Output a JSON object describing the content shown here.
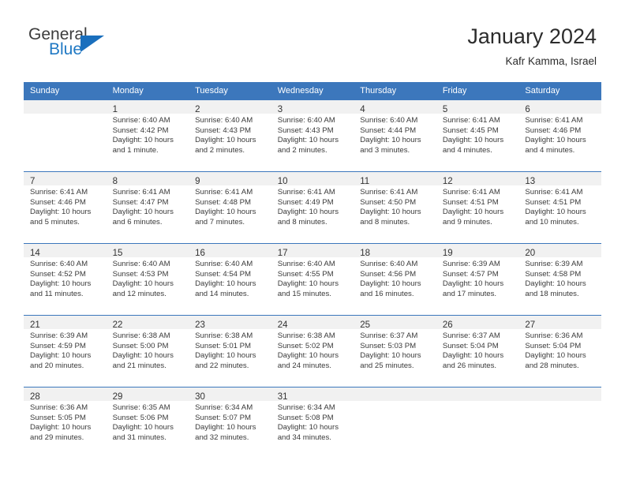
{
  "brand": {
    "name_top": "General",
    "name_bottom": "Blue",
    "color_dark": "#3c3c3c",
    "color_blue": "#2079c4"
  },
  "header": {
    "title": "January 2024",
    "subtitle": "Kafr Kamma, Israel"
  },
  "theme": {
    "header_blue": "#3c77bc",
    "daynum_band": "#f1f1f1",
    "text": "#3a3a3a"
  },
  "weekday_headers": [
    "Sunday",
    "Monday",
    "Tuesday",
    "Wednesday",
    "Thursday",
    "Friday",
    "Saturday"
  ],
  "labels": {
    "sunrise_prefix": "Sunrise:",
    "sunset_prefix": "Sunset:",
    "daylight_prefix": "Daylight:"
  },
  "weeks": [
    [
      {
        "day": "",
        "sunrise": "",
        "sunset": "",
        "daylight_line1": "",
        "daylight_line2": ""
      },
      {
        "day": "1",
        "sunrise": "Sunrise: 6:40 AM",
        "sunset": "Sunset: 4:42 PM",
        "daylight_line1": "Daylight: 10 hours",
        "daylight_line2": "and 1 minute."
      },
      {
        "day": "2",
        "sunrise": "Sunrise: 6:40 AM",
        "sunset": "Sunset: 4:43 PM",
        "daylight_line1": "Daylight: 10 hours",
        "daylight_line2": "and 2 minutes."
      },
      {
        "day": "3",
        "sunrise": "Sunrise: 6:40 AM",
        "sunset": "Sunset: 4:43 PM",
        "daylight_line1": "Daylight: 10 hours",
        "daylight_line2": "and 2 minutes."
      },
      {
        "day": "4",
        "sunrise": "Sunrise: 6:40 AM",
        "sunset": "Sunset: 4:44 PM",
        "daylight_line1": "Daylight: 10 hours",
        "daylight_line2": "and 3 minutes."
      },
      {
        "day": "5",
        "sunrise": "Sunrise: 6:41 AM",
        "sunset": "Sunset: 4:45 PM",
        "daylight_line1": "Daylight: 10 hours",
        "daylight_line2": "and 4 minutes."
      },
      {
        "day": "6",
        "sunrise": "Sunrise: 6:41 AM",
        "sunset": "Sunset: 4:46 PM",
        "daylight_line1": "Daylight: 10 hours",
        "daylight_line2": "and 4 minutes."
      }
    ],
    [
      {
        "day": "7",
        "sunrise": "Sunrise: 6:41 AM",
        "sunset": "Sunset: 4:46 PM",
        "daylight_line1": "Daylight: 10 hours",
        "daylight_line2": "and 5 minutes."
      },
      {
        "day": "8",
        "sunrise": "Sunrise: 6:41 AM",
        "sunset": "Sunset: 4:47 PM",
        "daylight_line1": "Daylight: 10 hours",
        "daylight_line2": "and 6 minutes."
      },
      {
        "day": "9",
        "sunrise": "Sunrise: 6:41 AM",
        "sunset": "Sunset: 4:48 PM",
        "daylight_line1": "Daylight: 10 hours",
        "daylight_line2": "and 7 minutes."
      },
      {
        "day": "10",
        "sunrise": "Sunrise: 6:41 AM",
        "sunset": "Sunset: 4:49 PM",
        "daylight_line1": "Daylight: 10 hours",
        "daylight_line2": "and 8 minutes."
      },
      {
        "day": "11",
        "sunrise": "Sunrise: 6:41 AM",
        "sunset": "Sunset: 4:50 PM",
        "daylight_line1": "Daylight: 10 hours",
        "daylight_line2": "and 8 minutes."
      },
      {
        "day": "12",
        "sunrise": "Sunrise: 6:41 AM",
        "sunset": "Sunset: 4:51 PM",
        "daylight_line1": "Daylight: 10 hours",
        "daylight_line2": "and 9 minutes."
      },
      {
        "day": "13",
        "sunrise": "Sunrise: 6:41 AM",
        "sunset": "Sunset: 4:51 PM",
        "daylight_line1": "Daylight: 10 hours",
        "daylight_line2": "and 10 minutes."
      }
    ],
    [
      {
        "day": "14",
        "sunrise": "Sunrise: 6:40 AM",
        "sunset": "Sunset: 4:52 PM",
        "daylight_line1": "Daylight: 10 hours",
        "daylight_line2": "and 11 minutes."
      },
      {
        "day": "15",
        "sunrise": "Sunrise: 6:40 AM",
        "sunset": "Sunset: 4:53 PM",
        "daylight_line1": "Daylight: 10 hours",
        "daylight_line2": "and 12 minutes."
      },
      {
        "day": "16",
        "sunrise": "Sunrise: 6:40 AM",
        "sunset": "Sunset: 4:54 PM",
        "daylight_line1": "Daylight: 10 hours",
        "daylight_line2": "and 14 minutes."
      },
      {
        "day": "17",
        "sunrise": "Sunrise: 6:40 AM",
        "sunset": "Sunset: 4:55 PM",
        "daylight_line1": "Daylight: 10 hours",
        "daylight_line2": "and 15 minutes."
      },
      {
        "day": "18",
        "sunrise": "Sunrise: 6:40 AM",
        "sunset": "Sunset: 4:56 PM",
        "daylight_line1": "Daylight: 10 hours",
        "daylight_line2": "and 16 minutes."
      },
      {
        "day": "19",
        "sunrise": "Sunrise: 6:39 AM",
        "sunset": "Sunset: 4:57 PM",
        "daylight_line1": "Daylight: 10 hours",
        "daylight_line2": "and 17 minutes."
      },
      {
        "day": "20",
        "sunrise": "Sunrise: 6:39 AM",
        "sunset": "Sunset: 4:58 PM",
        "daylight_line1": "Daylight: 10 hours",
        "daylight_line2": "and 18 minutes."
      }
    ],
    [
      {
        "day": "21",
        "sunrise": "Sunrise: 6:39 AM",
        "sunset": "Sunset: 4:59 PM",
        "daylight_line1": "Daylight: 10 hours",
        "daylight_line2": "and 20 minutes."
      },
      {
        "day": "22",
        "sunrise": "Sunrise: 6:38 AM",
        "sunset": "Sunset: 5:00 PM",
        "daylight_line1": "Daylight: 10 hours",
        "daylight_line2": "and 21 minutes."
      },
      {
        "day": "23",
        "sunrise": "Sunrise: 6:38 AM",
        "sunset": "Sunset: 5:01 PM",
        "daylight_line1": "Daylight: 10 hours",
        "daylight_line2": "and 22 minutes."
      },
      {
        "day": "24",
        "sunrise": "Sunrise: 6:38 AM",
        "sunset": "Sunset: 5:02 PM",
        "daylight_line1": "Daylight: 10 hours",
        "daylight_line2": "and 24 minutes."
      },
      {
        "day": "25",
        "sunrise": "Sunrise: 6:37 AM",
        "sunset": "Sunset: 5:03 PM",
        "daylight_line1": "Daylight: 10 hours",
        "daylight_line2": "and 25 minutes."
      },
      {
        "day": "26",
        "sunrise": "Sunrise: 6:37 AM",
        "sunset": "Sunset: 5:04 PM",
        "daylight_line1": "Daylight: 10 hours",
        "daylight_line2": "and 26 minutes."
      },
      {
        "day": "27",
        "sunrise": "Sunrise: 6:36 AM",
        "sunset": "Sunset: 5:04 PM",
        "daylight_line1": "Daylight: 10 hours",
        "daylight_line2": "and 28 minutes."
      }
    ],
    [
      {
        "day": "28",
        "sunrise": "Sunrise: 6:36 AM",
        "sunset": "Sunset: 5:05 PM",
        "daylight_line1": "Daylight: 10 hours",
        "daylight_line2": "and 29 minutes."
      },
      {
        "day": "29",
        "sunrise": "Sunrise: 6:35 AM",
        "sunset": "Sunset: 5:06 PM",
        "daylight_line1": "Daylight: 10 hours",
        "daylight_line2": "and 31 minutes."
      },
      {
        "day": "30",
        "sunrise": "Sunrise: 6:34 AM",
        "sunset": "Sunset: 5:07 PM",
        "daylight_line1": "Daylight: 10 hours",
        "daylight_line2": "and 32 minutes."
      },
      {
        "day": "31",
        "sunrise": "Sunrise: 6:34 AM",
        "sunset": "Sunset: 5:08 PM",
        "daylight_line1": "Daylight: 10 hours",
        "daylight_line2": "and 34 minutes."
      },
      {
        "day": "",
        "sunrise": "",
        "sunset": "",
        "daylight_line1": "",
        "daylight_line2": ""
      },
      {
        "day": "",
        "sunrise": "",
        "sunset": "",
        "daylight_line1": "",
        "daylight_line2": ""
      },
      {
        "day": "",
        "sunrise": "",
        "sunset": "",
        "daylight_line1": "",
        "daylight_line2": ""
      }
    ]
  ]
}
